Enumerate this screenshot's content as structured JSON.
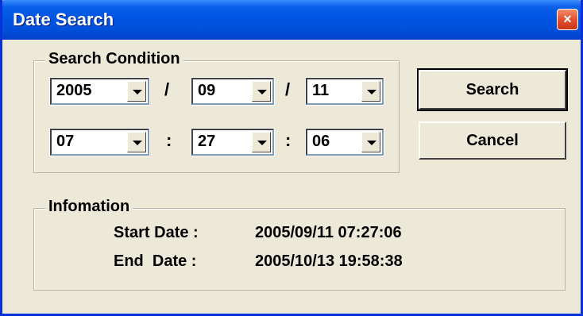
{
  "window": {
    "title": "Date Search",
    "close_label": "×"
  },
  "search_condition": {
    "legend": "Search Condition",
    "year": "2005",
    "month": "09",
    "day": "11",
    "hour": "07",
    "minute": "27",
    "second": "06",
    "date_separator": "/",
    "time_separator": ":"
  },
  "buttons": {
    "search": "Search",
    "cancel": "Cancel"
  },
  "information": {
    "legend": "Infomation",
    "start_label": "Start Date :",
    "start_value": "2005/09/11 07:27:06",
    "end_label": "End  Date :",
    "end_value": "2005/10/13 19:58:38"
  }
}
